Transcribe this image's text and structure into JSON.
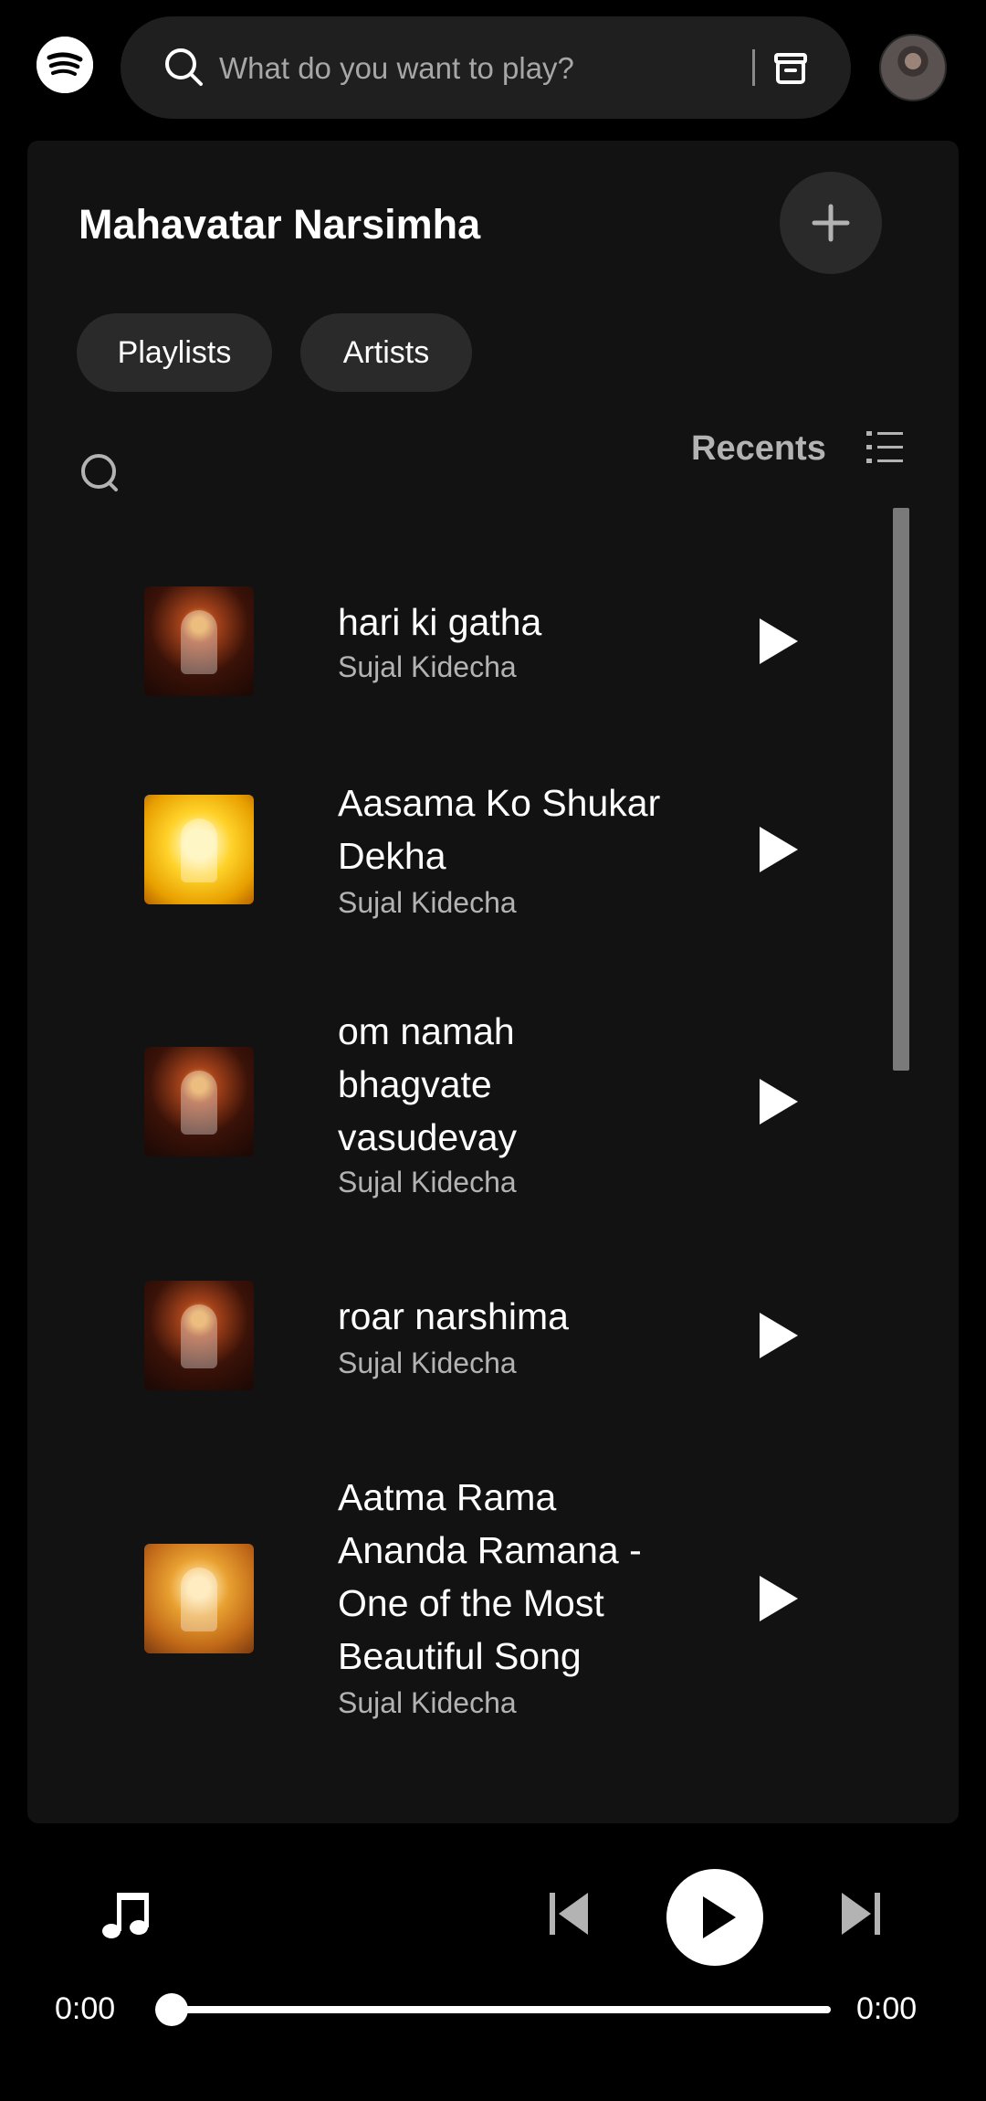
{
  "search": {
    "placeholder": "What do you want to play?"
  },
  "library": {
    "title": "Mahavatar Narsimha",
    "filters": [
      "Playlists",
      "Artists"
    ],
    "sort_label": "Recents"
  },
  "tracks": [
    {
      "title": "hari ki gatha",
      "artist": "Sujal Kidecha",
      "cover": "dark"
    },
    {
      "title": "Aasama Ko Shukar Dekha",
      "artist": "Sujal Kidecha",
      "cover": "yellow"
    },
    {
      "title": "om namah bhagvate vasudevay",
      "artist": "Sujal Kidecha",
      "cover": "dark"
    },
    {
      "title": "roar narshima",
      "artist": "Sujal Kidecha",
      "cover": "dark"
    },
    {
      "title": "Aatma Rama Ananda Ramana - One of the Most Beautiful Song",
      "artist": "Sujal Kidecha",
      "cover": "gold"
    }
  ],
  "player": {
    "elapsed": "0:00",
    "duration": "0:00",
    "progress": 0
  },
  "colors": {
    "background": "#000000",
    "panel": "#121212",
    "chip": "#2a2a2a",
    "text_secondary": "#b3b3b3"
  },
  "icons": [
    "spotify-logo-icon",
    "search-icon",
    "browse-icon",
    "plus-icon",
    "list-view-icon",
    "play-icon",
    "music-note-icon",
    "skip-previous-icon",
    "skip-next-icon"
  ]
}
